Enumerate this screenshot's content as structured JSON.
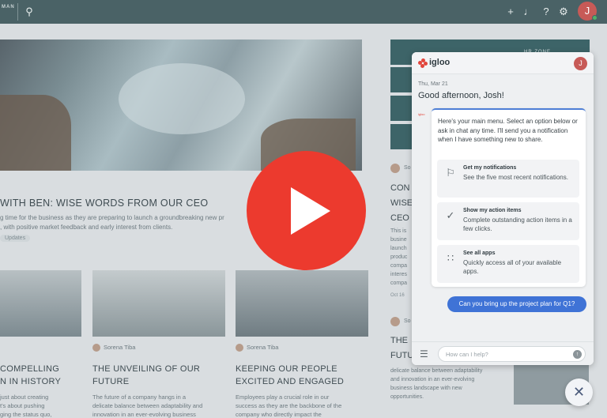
{
  "topbar": {
    "brand": "MAN",
    "icons": [
      "search-icon",
      "plus-icon",
      "bell-icon",
      "help-icon",
      "gear-icon"
    ],
    "avatar_initial": "J"
  },
  "feature": {
    "headline": "WITH BEN: WISE WORDS FROM OUR CEO",
    "excerpt_line1": "g time for the business as they are preparing to launch a groundbreaking new pr",
    "excerpt_line2": ", with positive market feedback and early interest from clients.",
    "tag": "Updates"
  },
  "cards": [
    {
      "author": "",
      "title_line1": "COMPELLING",
      "title_line2": "N IN HISTORY",
      "text_line1": "just about creating",
      "text_line2": "t's about pushing",
      "text_line3": "ging the status quo,"
    },
    {
      "author": "Sorena Tiba",
      "title_line1": "THE UNVEILING OF OUR",
      "title_line2": "FUTURE",
      "text_line1": "The future of a company hangs in a",
      "text_line2": "delicate balance between adaptability and",
      "text_line3": "innovation in an ever-evolving business"
    },
    {
      "author": "Sorena Tiba",
      "title_line1": "KEEPING OUR PEOPLE",
      "title_line2": "EXCITED AND ENGAGED",
      "text_line1": "Employees play a crucial role in our",
      "text_line2": "success as they are the backbone of the",
      "text_line3": "company who directly impact the"
    }
  ],
  "right_column": {
    "zone_label": "HR ZONE",
    "post1": {
      "author": "So",
      "title_line1": "CON",
      "title_line2": "WISE",
      "title_line3": "CEO",
      "text_line1": "This is",
      "text_line2": "busine",
      "text_line3": "launch",
      "text_line4": "produc",
      "text_line5": "compa",
      "text_line6": "interes",
      "text_line7": "compa",
      "date": "Oct 16"
    },
    "post2": {
      "author": "So",
      "title_line1": "THE",
      "title_line2": "FUTU",
      "text_line1": "delicate balance between adaptability",
      "text_line2": "and innovation in an ever-evolving",
      "text_line3": "business landscape with new",
      "text_line4": "opportunities."
    }
  },
  "chat": {
    "logo_text": "igloo",
    "avatar_initial": "J",
    "date": "Thu, Mar 21",
    "greeting": "Good afternoon, Josh!",
    "bot_label": "igloo",
    "intro": "Here's your main menu. Select an option below or ask in chat any time. I'll send you a notification when I have something new to share.",
    "options": [
      {
        "title": "Get my notifications",
        "desc": "See the five most recent notifications.",
        "icon": "flag-icon"
      },
      {
        "title": "Show my action items",
        "desc": "Complete outstanding action items in a few clicks.",
        "icon": "check-circle-icon"
      },
      {
        "title": "See all apps",
        "desc": "Quickly access all of your available apps.",
        "icon": "apps-grid-icon"
      }
    ],
    "user_message": "Can you bring up the project plan for Q1?",
    "input_placeholder": "How can I help?"
  },
  "video": {
    "icon": "play-icon"
  },
  "fab": {
    "icon": "close-icon"
  },
  "colors": {
    "accent": "#3f73d6",
    "brand_red": "#e2463c",
    "play_red": "#ec3a2e",
    "topbar": "#4a6266"
  }
}
